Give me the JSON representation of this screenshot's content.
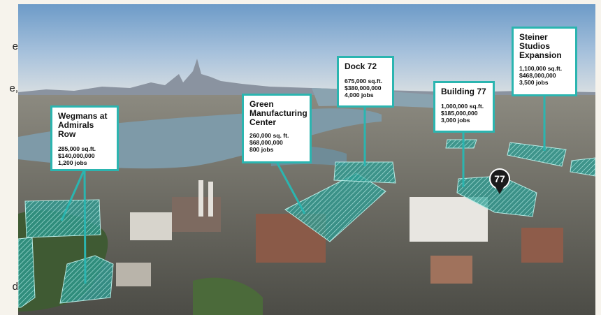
{
  "edge_text": {
    "e1": "e",
    "e2": "e,",
    "e3": "d"
  },
  "pin_label": "77",
  "colors": {
    "accent": "#2bb5b0",
    "zone_fill": "#2a9d94",
    "sky_top": "#6d9bc8",
    "water": "#7e9aa8"
  },
  "callouts": [
    {
      "name": "Wegmans at Admirals Row",
      "sqft": "285,000 sq.ft.",
      "cost": "$140,000,000",
      "jobs": "1,200 jobs"
    },
    {
      "name": "Green Manufacturing Center",
      "sqft": "260,000 sq. ft.",
      "cost": "$68,000,000",
      "jobs": "800 jobs"
    },
    {
      "name": "Dock 72",
      "sqft": "675,000 sq.ft.",
      "cost": "$380,000,000",
      "jobs": "4,000 jobs"
    },
    {
      "name": "Building 77",
      "sqft": "1,000,000 sq.ft.",
      "cost": "$185,000,000",
      "jobs": "3,000 jobs"
    },
    {
      "name": "Steiner Studios Expansion",
      "sqft": "1,100,000 sq.ft.",
      "cost": "$468,000,000",
      "jobs": "3,500 jobs"
    }
  ]
}
